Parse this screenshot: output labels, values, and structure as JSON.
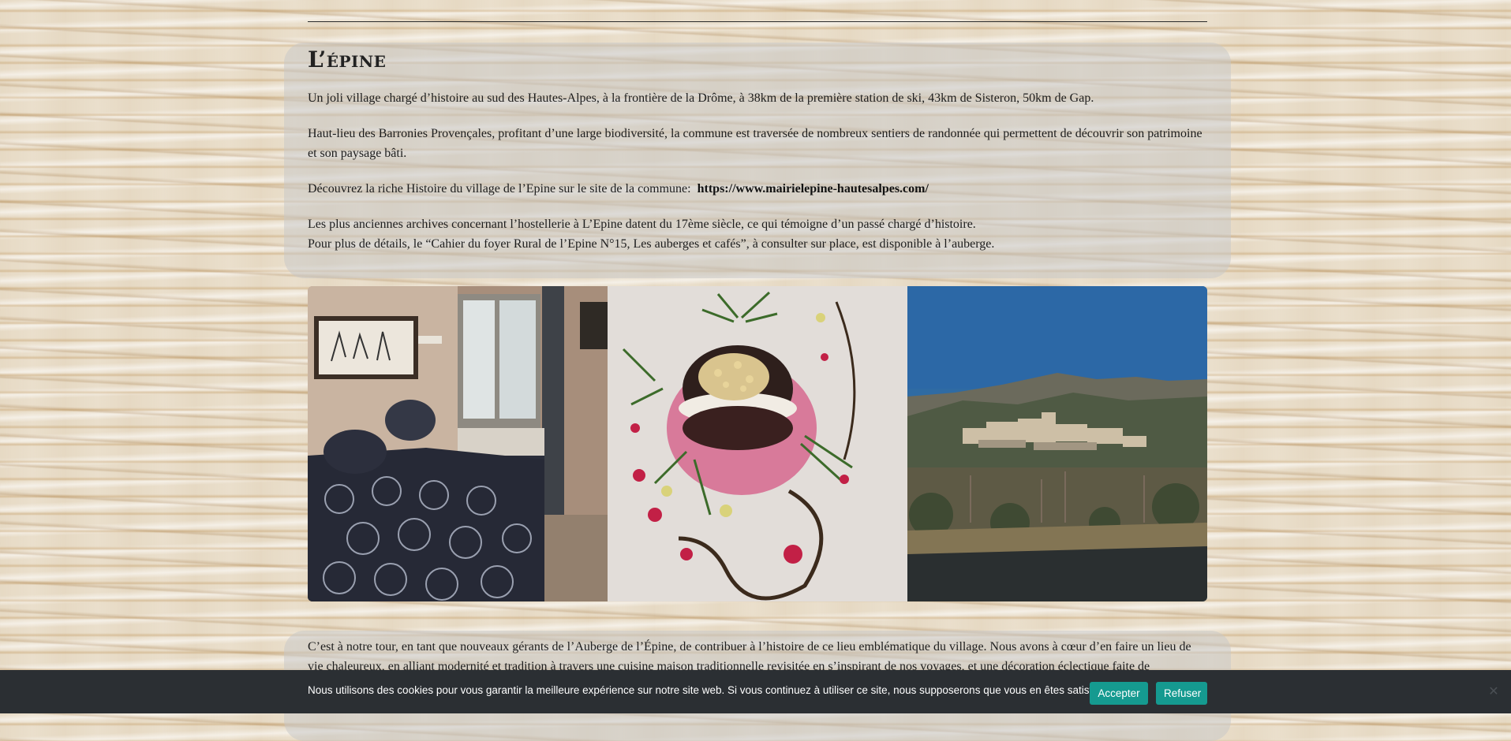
{
  "section": {
    "title": "L’épine",
    "paragraphs": {
      "intro": "Un joli village chargé d’histoire au sud des Hautes-Alpes, à la frontière de la Drôme, à 38km de la première station de ski, 43km de Sisteron, 50km de Gap.",
      "barronies": "Haut-lieu des Barronies Provençales, profitant d’une large biodiversité, la commune est traversée de nombreux sentiers de randonnée qui permettent de découvrir son patrimoine et son paysage bâti.",
      "history_prefix": "Découvrez la riche Histoire du village de l’Epine sur le site de la commune: ",
      "history_link": "https://www.mairielepine-hautesalpes.com/",
      "archives_line1": "Les plus anciennes archives concernant l’hostellerie à L’Epine datent du 17ème siècle, ce qui témoigne d’un passé chargé d’histoire.",
      "archives_line2": "Pour plus de détails, le “Cahier du foyer Rural de l’Epine N°15, Les auberges et cafés”, à consulter sur place, est disponible à l’auberge."
    }
  },
  "gallery": {
    "photos": [
      "bedroom-photo",
      "dessert-plate-photo",
      "village-landscape-photo"
    ]
  },
  "section2": {
    "paragraph": "C’est à notre tour, en tant que nouveaux gérants de l’Auberge de l’Épine, de contribuer à l’histoire de ce lieu emblématique du village. Nous avons à cœur d’en faire un lieu de vie chaleureux, en alliant modernité et tradition à travers une cuisine maison traditionnelle revisitée en s’inspirant de nos voyages, et une décoration éclectique faite de"
  },
  "cookie": {
    "message": "Nous utilisons des cookies pour vous garantir la meilleure expérience sur notre site web. Si vous continuez à utiliser ce site, nous supposerons que vous en êtes satisfait.",
    "accept_label": "Accepter",
    "refuse_label": "Refuser",
    "close_icon": "close-icon",
    "button_color": "#159a90",
    "bar_color": "#2b2f33"
  }
}
